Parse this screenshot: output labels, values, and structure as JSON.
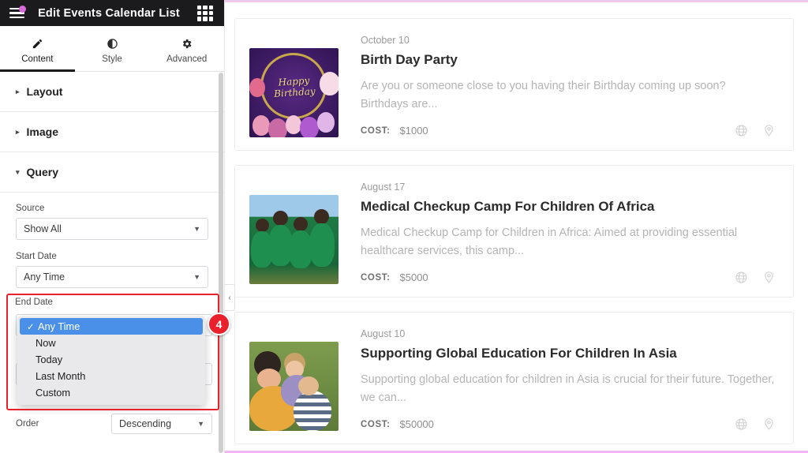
{
  "panel": {
    "header": {
      "title": "Edit Events Calendar List",
      "menu_icon": "hamburger-menu-icon",
      "badge_dot": "notification-dot",
      "apps_icon": "grid-apps-icon"
    },
    "tabs": [
      {
        "label": "Content",
        "icon": "pencil-icon",
        "active": true
      },
      {
        "label": "Style",
        "icon": "contrast-half-circle-icon",
        "active": false
      },
      {
        "label": "Advanced",
        "icon": "gear-icon",
        "active": false
      }
    ],
    "sections": [
      {
        "label": "Layout",
        "expanded": false,
        "caret": "▸"
      },
      {
        "label": "Image",
        "expanded": false,
        "caret": "▸"
      },
      {
        "label": "Query",
        "expanded": true,
        "caret": "▾"
      }
    ],
    "query": {
      "source": {
        "label": "Source",
        "value": "Show All"
      },
      "start_date": {
        "label": "Start Date",
        "value": "Any Time"
      },
      "end_date": {
        "label": "End Date",
        "value": "Any Time"
      },
      "order": {
        "label": "Order",
        "value": "Descending"
      },
      "dropdown": {
        "open": true,
        "options": [
          {
            "label": "Any Time",
            "selected": true,
            "check": "✓"
          },
          {
            "label": "Now",
            "selected": false,
            "check": ""
          },
          {
            "label": "Today",
            "selected": false,
            "check": ""
          },
          {
            "label": "Last Month",
            "selected": false,
            "check": ""
          },
          {
            "label": "Custom",
            "selected": false,
            "check": ""
          }
        ]
      }
    },
    "annotation": {
      "badge_number": "4",
      "highlight_color": "#e8212c"
    },
    "collapse_handle": {
      "icon": "chevron-left-icon",
      "glyph": "‹"
    }
  },
  "preview": {
    "frame_color_top": "#f0c8ee",
    "frame_color_bottom": "#f3b8f0",
    "cost_label": "COST:",
    "cards": [
      {
        "date": "October 10",
        "title": "Birth Day Party",
        "description": "Are you or someone close to you having their Birthday coming up soon? Birthdays are...",
        "cost": "$1000",
        "thumb_alt": "happy-birthday-balloons-image",
        "thumb_text": "Happy\nBirthday",
        "icons": [
          "globe-icon",
          "location-pin-icon"
        ]
      },
      {
        "date": "August 17",
        "title": "Medical Checkup Camp For Children Of Africa",
        "description": "Medical Checkup Camp for Children in Africa: Aimed at providing essential healthcare services, this camp...",
        "cost": "$5000",
        "thumb_alt": "african-children-in-green-uniforms-image",
        "icons": [
          "globe-icon",
          "location-pin-icon"
        ]
      },
      {
        "date": "August 10",
        "title": "Supporting Global Education For Children In Asia",
        "description": "Supporting global education for children in Asia is crucial for their future. Together, we can...",
        "cost": "$50000",
        "thumb_alt": "children-hugging-outdoors-image",
        "icons": [
          "globe-icon",
          "location-pin-icon"
        ]
      }
    ]
  }
}
